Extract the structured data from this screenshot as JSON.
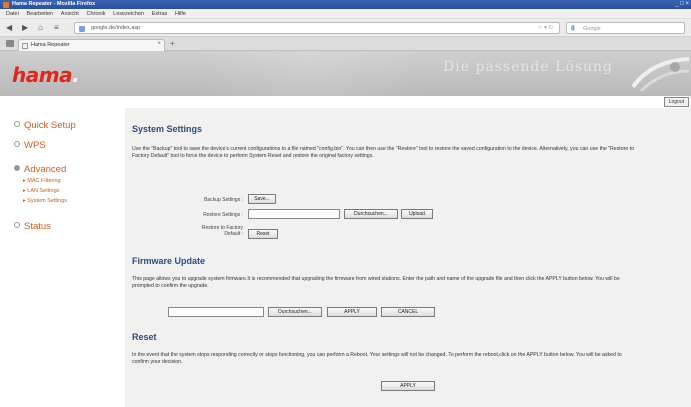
{
  "window": {
    "title": "Hama Repeater - Mozilla Firefox",
    "controls": "_ □ ×"
  },
  "menu": [
    "Datei",
    "Bearbeiten",
    "Ansicht",
    "Chronik",
    "Lesezeichen",
    "Extras",
    "Hilfe"
  ],
  "toolbar": {
    "url": "google.de/index.asp",
    "search_placeholder": "Google",
    "search_engine_icon": "g-icon"
  },
  "tab": {
    "label": "Hama Repeater"
  },
  "banner": {
    "logo": "hama",
    "logo_dot": ".",
    "slogan": "Die passende Lösung"
  },
  "logout_label": "Logout",
  "sidebar": {
    "items": [
      {
        "label": "Quick Setup"
      },
      {
        "label": "WPS"
      },
      {
        "label": "Advanced"
      },
      {
        "label": "Status"
      }
    ],
    "subitems": [
      {
        "label": "▸ MAC Filtering"
      },
      {
        "label": "▸ LAN Settings"
      },
      {
        "label": "▸ System Settings"
      }
    ]
  },
  "system_settings": {
    "title": "System Settings",
    "description": "Use the \"Backup\" tool to save the device's current configurations to a file named \"config.bin\". You can then use the \"Restore\" tool to restore the saved configuration to the device. Alternatively, you can use the \"Restore to Factory Default\" tool to force the device to perform System Reset and restore the original factory settings.",
    "backup_label": "Backup Settings :",
    "backup_button": "Save...",
    "restore_label": "Restore Settings :",
    "browse_button": "Durchsuchen...",
    "upload_button": "Upload",
    "factory_label_line1": "Restore to Factory",
    "factory_label_line2": "Default :",
    "reset_button": "Reset"
  },
  "firmware_update": {
    "title": "Firmware Update",
    "description": "This page allows you to upgrade system firmware.It is recommended that upgrading the firmware from wired stations. Enter the path and name of the upgrade file and then click the APPLY button below. You will be prompted to confirm the upgrade.",
    "browse_button": "Durchsuchen...",
    "apply_button": "APPLY",
    "cancel_button": "CANCEL"
  },
  "reset": {
    "title": "Reset",
    "description": "In the event that the system stops responding correctly or stops functioning, you can perform a Reboot. Your settings will not be changed. To perform the reboot,click on the APPLY button below. You will be asked to confirm your decision.",
    "apply_button": "APPLY"
  },
  "colors": {
    "brand_red": "#e1261c",
    "nav_orange": "#d15e1e",
    "heading_blue": "#2d4d7a"
  }
}
